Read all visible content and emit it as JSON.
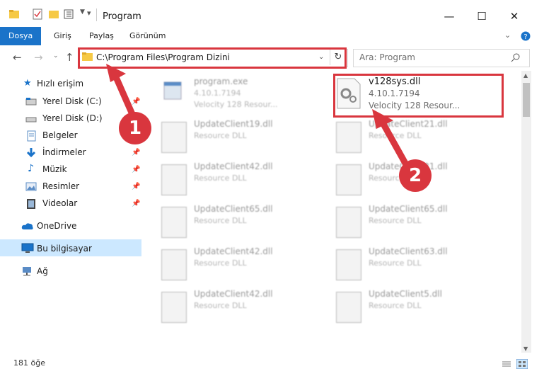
{
  "window": {
    "title": "Program"
  },
  "ribbon": {
    "tabs": [
      "Dosya",
      "Giriş",
      "Paylaş",
      "Görünüm"
    ]
  },
  "address": {
    "path": "C:\\Program Files\\Program Dizini"
  },
  "search": {
    "placeholder": "Ara: Program"
  },
  "sidebar": {
    "items": [
      {
        "label": "Hızlı erişim"
      },
      {
        "label": "Yerel Disk (C:)"
      },
      {
        "label": "Yerel Disk (D:)"
      },
      {
        "label": "Belgeler"
      },
      {
        "label": "İndirmeler"
      },
      {
        "label": "Müzik"
      },
      {
        "label": "Resimler"
      },
      {
        "label": "Videolar"
      },
      {
        "label": "OneDrive"
      },
      {
        "label": "Bu bilgisayar"
      },
      {
        "label": "Ağ"
      }
    ]
  },
  "files": [
    {
      "name": "program.exe",
      "version": "4.10.1.7194",
      "desc": "Velocity 128 Resour..."
    },
    {
      "name": "v128sys.dll",
      "version": "4.10.1.7194",
      "desc": "Velocity 128 Resour..."
    },
    {
      "name": "UpdateClient19.dll",
      "desc": "Resource DLL"
    },
    {
      "name": "UpdateClient21.dll",
      "desc": "Resource DLL"
    },
    {
      "name": "UpdateClient42.dll",
      "desc": "Resource DLL"
    },
    {
      "name": "UpdateClient21.dll",
      "desc": "Resource DLL"
    },
    {
      "name": "UpdateClient65.dll",
      "desc": "Resource DLL"
    },
    {
      "name": "UpdateClient65.dll",
      "desc": "Resource DLL"
    },
    {
      "name": "UpdateClient42.dll",
      "desc": "Resource DLL"
    },
    {
      "name": "UpdateClient63.dll",
      "desc": "Resource DLL"
    },
    {
      "name": "UpdateClient42.dll",
      "desc": "Resource DLL"
    },
    {
      "name": "UpdateClient5.dll",
      "desc": "Resource DLL"
    }
  ],
  "annotations": {
    "step1": "1",
    "step2": "2"
  },
  "status": {
    "count": "181 öğe"
  },
  "colors": {
    "accent": "#1a73c9",
    "highlight": "#d9363e",
    "selected": "#cce8ff"
  }
}
